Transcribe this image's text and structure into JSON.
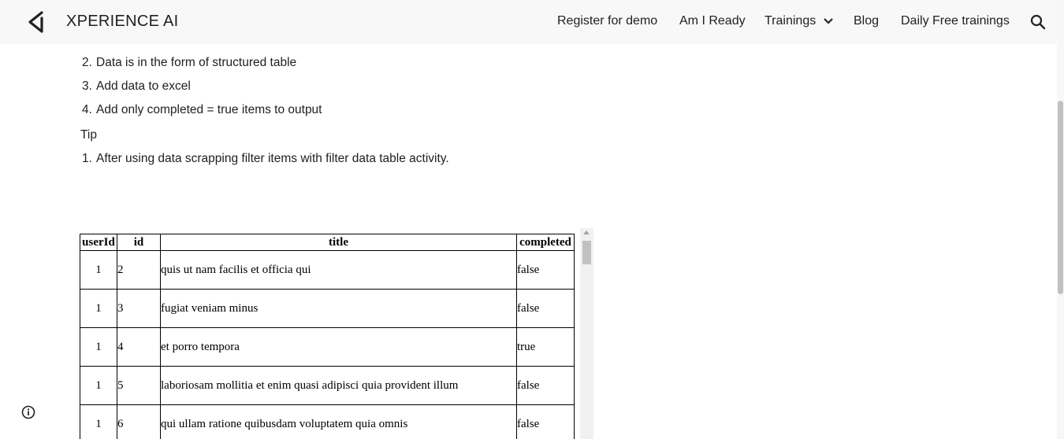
{
  "header": {
    "brand": "XPERIENCE AI",
    "nav": [
      {
        "label": "Register for demo"
      },
      {
        "label": "Am I Ready"
      },
      {
        "label": "Trainings"
      },
      {
        "label": "Blog"
      },
      {
        "label": "Daily Free trainings"
      }
    ],
    "icons": {
      "logo": "xperience-logo-icon",
      "dropdown": "chevron-down-icon",
      "search": "search-icon"
    }
  },
  "content": {
    "requirements": [
      {
        "num": "2.",
        "text": "Data is in the form of structured table"
      },
      {
        "num": "3.",
        "text": "Add data to excel"
      },
      {
        "num": "4.",
        "text": "Add only completed = true items to output"
      }
    ],
    "tip_heading": "Tip",
    "tips": [
      {
        "num": "1.",
        "text": "After using data scrapping filter items with filter data table activity."
      }
    ]
  },
  "table": {
    "headers": [
      "userId",
      "id",
      "title",
      "completed"
    ],
    "rows": [
      [
        "1",
        "2",
        "quis ut nam facilis et officia qui",
        "false"
      ],
      [
        "1",
        "3",
        "fugiat veniam minus",
        "false"
      ],
      [
        "1",
        "4",
        "et porro tempora",
        "true"
      ],
      [
        "1",
        "5",
        "laboriosam mollitia et enim quasi adipisci quia provident illum",
        "false"
      ],
      [
        "1",
        "6",
        "qui ullam ratione quibusdam voluptatem quia omnis",
        "false"
      ]
    ]
  },
  "footer": {
    "info_icon": "info-icon"
  }
}
